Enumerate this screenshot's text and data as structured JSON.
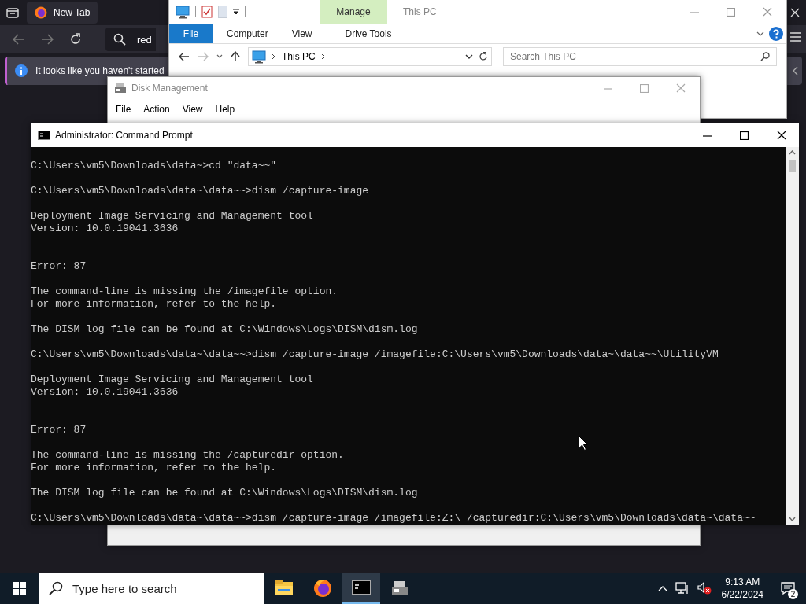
{
  "browser": {
    "tab": {
      "title": "New Tab",
      "selected": true
    },
    "address": {
      "value": "red"
    },
    "notice": {
      "text": "It looks like you haven't started"
    }
  },
  "explorer": {
    "title": "This PC",
    "context_tab": {
      "label": "Manage"
    },
    "ribbon_tabs": [
      {
        "label": "File",
        "kind": "file"
      },
      {
        "label": "Computer",
        "kind": "tab"
      },
      {
        "label": "View",
        "kind": "tab"
      },
      {
        "label": "Drive Tools",
        "kind": "tab"
      }
    ],
    "breadcrumb": "This PC",
    "search": {
      "placeholder": "Search This PC"
    }
  },
  "disk_management": {
    "title": "Disk Management",
    "menu": [
      "File",
      "Action",
      "View",
      "Help"
    ]
  },
  "command_prompt": {
    "title": "Administrator: Command Prompt",
    "lines": [
      {
        "kind": "blank"
      },
      {
        "kind": "text",
        "text": "C:\\Users\\vm5\\Downloads\\data~>cd \"data~~\""
      },
      {
        "kind": "blank"
      },
      {
        "kind": "text",
        "text": "C:\\Users\\vm5\\Downloads\\data~\\data~~>dism /capture-image"
      },
      {
        "kind": "blank"
      },
      {
        "kind": "text",
        "text": "Deployment Image Servicing and Management tool"
      },
      {
        "kind": "text",
        "text": "Version: 10.0.19041.3636"
      },
      {
        "kind": "blank"
      },
      {
        "kind": "blank"
      },
      {
        "kind": "text",
        "text": "Error: 87"
      },
      {
        "kind": "blank"
      },
      {
        "kind": "text",
        "text": "The command-line is missing the /imagefile option."
      },
      {
        "kind": "text",
        "text": "For more information, refer to the help."
      },
      {
        "kind": "blank"
      },
      {
        "kind": "text",
        "text": "The DISM log file can be found at C:\\Windows\\Logs\\DISM\\dism.log"
      },
      {
        "kind": "blank"
      },
      {
        "kind": "text",
        "text": "C:\\Users\\vm5\\Downloads\\data~\\data~~>dism /capture-image /imagefile:C:\\Users\\vm5\\Downloads\\data~\\data~~\\UtilityVM"
      },
      {
        "kind": "blank"
      },
      {
        "kind": "text",
        "text": "Deployment Image Servicing and Management tool"
      },
      {
        "kind": "text",
        "text": "Version: 10.0.19041.3636"
      },
      {
        "kind": "blank"
      },
      {
        "kind": "blank"
      },
      {
        "kind": "text",
        "text": "Error: 87"
      },
      {
        "kind": "blank"
      },
      {
        "kind": "text",
        "text": "The command-line is missing the /capturedir option."
      },
      {
        "kind": "text",
        "text": "For more information, refer to the help."
      },
      {
        "kind": "blank"
      },
      {
        "kind": "text",
        "text": "The DISM log file can be found at C:\\Windows\\Logs\\DISM\\dism.log"
      },
      {
        "kind": "blank"
      },
      {
        "kind": "text",
        "text": "C:\\Users\\vm5\\Downloads\\data~\\data~~>dism /capture-image /imagefile:Z:\\ /capturedir:C:\\Users\\vm5\\Downloads\\data~\\data~~"
      }
    ]
  },
  "taskbar": {
    "search": {
      "placeholder": "Type here to search"
    },
    "apps": [
      {
        "kind": "folder",
        "selected": false
      },
      {
        "kind": "browser",
        "selected": false
      },
      {
        "kind": "terminal",
        "selected": true
      },
      {
        "kind": "disk",
        "selected": false
      }
    ],
    "time": "9:13 AM",
    "date": "6/22/2024",
    "notifications": "2"
  }
}
